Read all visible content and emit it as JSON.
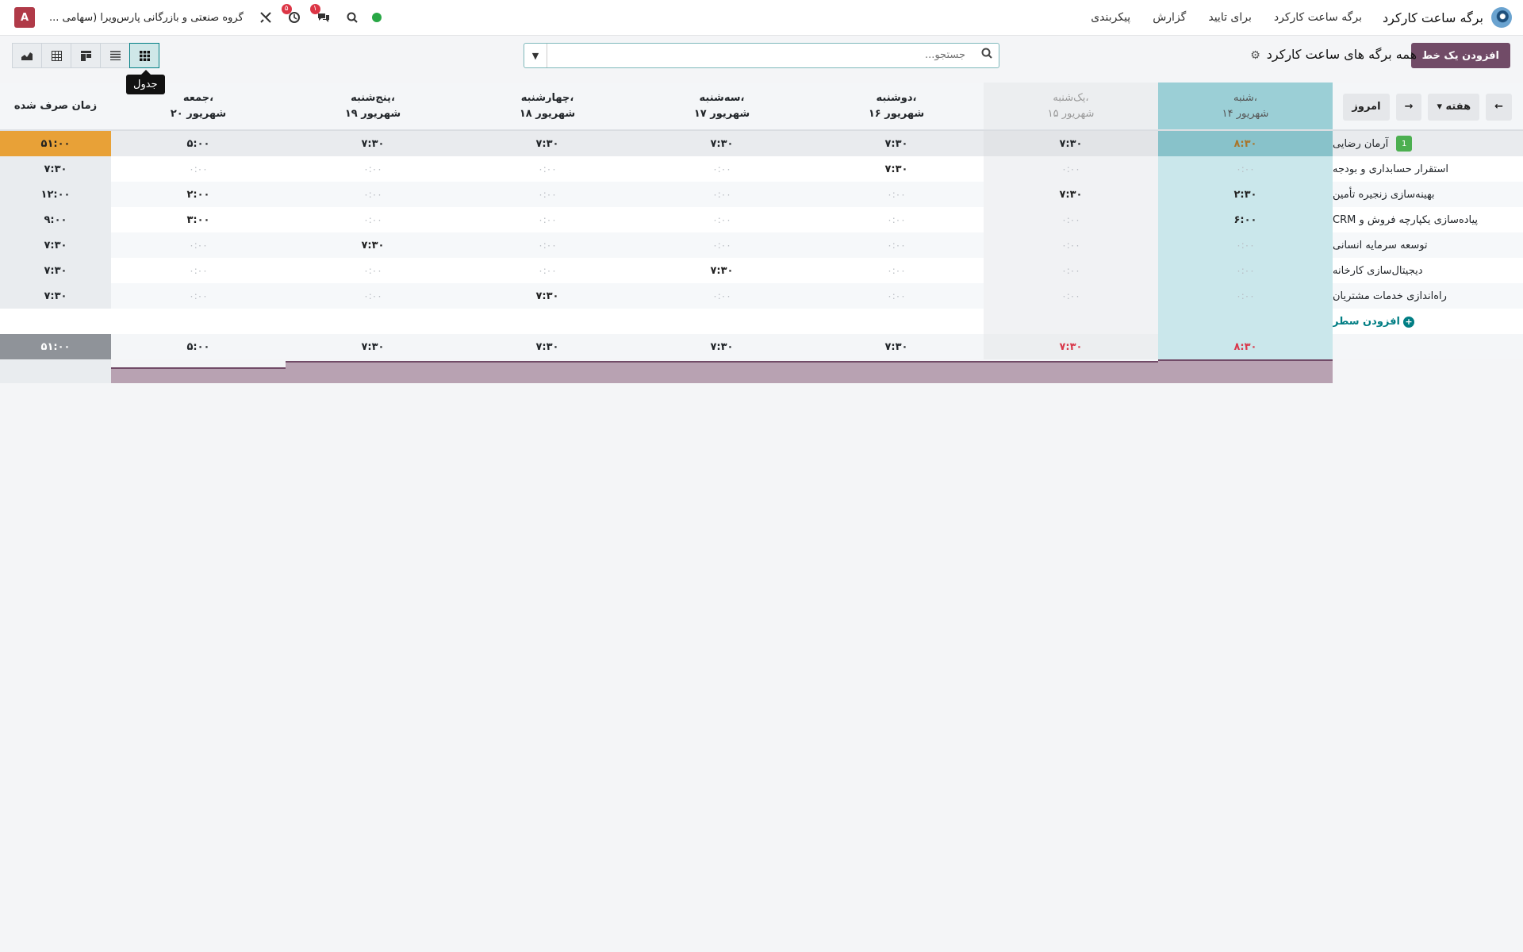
{
  "topbar": {
    "app_title": "برگه ساعت کارکرد",
    "menu": [
      "برگه ساعت کارکرد",
      "برای تایید",
      "گزارش",
      "پیکربندی"
    ],
    "company": "گروه صنعتی و بازرگانی پارس‌ویرا (سهامی ...",
    "avatar_letter": "A",
    "activity_badge": "۵",
    "chat_badge": "۱"
  },
  "controlbar": {
    "add_line_label": "افزودن یک خط",
    "view_title": "همه برگه های ساعت کارکرد",
    "search_placeholder": "جستجو...",
    "tooltip": "جدول"
  },
  "navigation": {
    "today": "امروز",
    "range": "هفته"
  },
  "columns": [
    {
      "day": "شنبه،",
      "date": "شهریور ۱۴"
    },
    {
      "day": "یک‌شنبه،",
      "date": "شهریور ۱۵"
    },
    {
      "day": "دوشنبه،",
      "date": "شهریور ۱۶"
    },
    {
      "day": "سه‌شنبه،",
      "date": "شهریور ۱۷"
    },
    {
      "day": "چهارشنبه،",
      "date": "شهریور ۱۸"
    },
    {
      "day": "پنج‌شنبه،",
      "date": "شهریور ۱۹"
    },
    {
      "day": "جمعه،",
      "date": "شهریور ۲۰"
    }
  ],
  "total_header": "زمان صرف شده",
  "employee": {
    "badge": "1",
    "name": "آرمان رضایی",
    "values": [
      "۸:۳۰",
      "۷:۳۰",
      "۷:۳۰",
      "۷:۳۰",
      "۷:۳۰",
      "۷:۳۰",
      "۵:۰۰"
    ],
    "total": "۵۱:۰۰"
  },
  "projects": [
    {
      "name": "استقرار حسابداری و بودجه",
      "values": [
        "۰:۰۰",
        "۰:۰۰",
        "۷:۳۰",
        "۰:۰۰",
        "۰:۰۰",
        "۰:۰۰",
        "۰:۰۰"
      ],
      "total": "۷:۳۰"
    },
    {
      "name": "بهینه‌سازی زنجیره تأمین",
      "values": [
        "۲:۳۰",
        "۷:۳۰",
        "۰:۰۰",
        "۰:۰۰",
        "۰:۰۰",
        "۰:۰۰",
        "۲:۰۰"
      ],
      "total": "۱۲:۰۰"
    },
    {
      "name": "پیاده‌سازی یکپارچه فروش و CRM",
      "values": [
        "۶:۰۰",
        "۰:۰۰",
        "۰:۰۰",
        "۰:۰۰",
        "۰:۰۰",
        "۰:۰۰",
        "۳:۰۰"
      ],
      "total": "۹:۰۰"
    },
    {
      "name": "توسعه سرمایه انسانی",
      "values": [
        "۰:۰۰",
        "۰:۰۰",
        "۰:۰۰",
        "۰:۰۰",
        "۰:۰۰",
        "۷:۳۰",
        "۰:۰۰"
      ],
      "total": "۷:۳۰"
    },
    {
      "name": "دیجیتال‌سازی کارخانه",
      "values": [
        "۰:۰۰",
        "۰:۰۰",
        "۰:۰۰",
        "۷:۳۰",
        "۰:۰۰",
        "۰:۰۰",
        "۰:۰۰"
      ],
      "total": "۷:۳۰"
    },
    {
      "name": "راه‌اندازی خدمات مشتریان",
      "values": [
        "۰:۰۰",
        "۰:۰۰",
        "۰:۰۰",
        "۰:۰۰",
        "۷:۳۰",
        "۰:۰۰",
        "۰:۰۰"
      ],
      "total": "۷:۳۰"
    }
  ],
  "add_row_label": "افزودن سطر",
  "totals": {
    "values": [
      "۸:۳۰",
      "۷:۳۰",
      "۷:۳۰",
      "۷:۳۰",
      "۷:۳۰",
      "۷:۳۰",
      "۵:۰۰"
    ],
    "grand_total": "۵۱:۰۰"
  },
  "colors": {
    "brand": "#714b67",
    "accent": "#017e84",
    "today_column": "#9bcfd6",
    "overtime_total": "#e8a137",
    "warning_text": "#d9394c"
  }
}
